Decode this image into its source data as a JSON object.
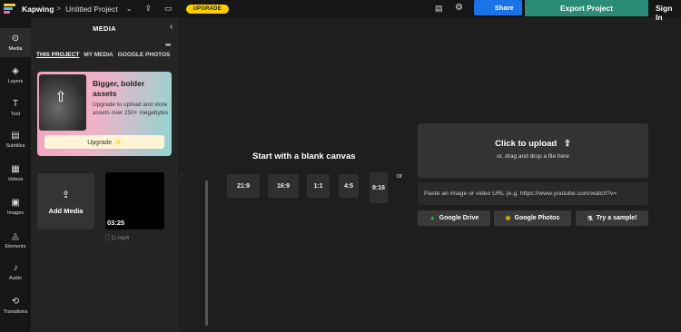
{
  "topbar": {
    "brand": "Kapwing",
    "crumb_sep": ">",
    "project_title": "Untitled Project",
    "upgrade_label": "UPGRADE",
    "share_label": "Share",
    "export_label": "Export Project",
    "signin_label": "Sign In"
  },
  "leftnav": {
    "items": [
      {
        "label": "Media",
        "icon": "media-icon"
      },
      {
        "label": "Layers",
        "icon": "layers-icon"
      },
      {
        "label": "Text",
        "icon": "text-icon"
      },
      {
        "label": "Subtitles",
        "icon": "subtitles-icon"
      },
      {
        "label": "Videos",
        "icon": "videos-icon"
      },
      {
        "label": "Images",
        "icon": "images-icon"
      },
      {
        "label": "Elements",
        "icon": "elements-icon"
      },
      {
        "label": "Audio",
        "icon": "audio-icon"
      },
      {
        "label": "Transitions",
        "icon": "transitions-icon"
      }
    ]
  },
  "panel": {
    "title": "MEDIA",
    "tabs": [
      "THIS PROJECT",
      "MY MEDIA",
      "GOOGLE PHOTOS"
    ],
    "promo": {
      "title": "Bigger, bolder assets",
      "description": "Upgrade to upload and store assets over 250+ megabytes",
      "button": "Upgrade ✨"
    },
    "add_media_label": "Add Media",
    "clip": {
      "duration": "03:25",
      "name": "D.mp4"
    }
  },
  "canvas": {
    "title": "Start with a blank canvas",
    "ratios": [
      "21:9",
      "16:9",
      "1:1",
      "4:5",
      "9:16"
    ],
    "or_label": "or"
  },
  "upload": {
    "title": "Click to upload",
    "subtitle": "or, drag and drop a file here",
    "url_placeholder": "Paste an image or video URL (e.g. https://www.youtube.com/watch?v=",
    "sources": [
      "Google Drive",
      "Google Photos",
      "Try a sample!"
    ]
  },
  "colors": {
    "accent_yellow": "#ffce00",
    "share_blue": "#1a73e8",
    "export_green": "#2a8c77"
  }
}
